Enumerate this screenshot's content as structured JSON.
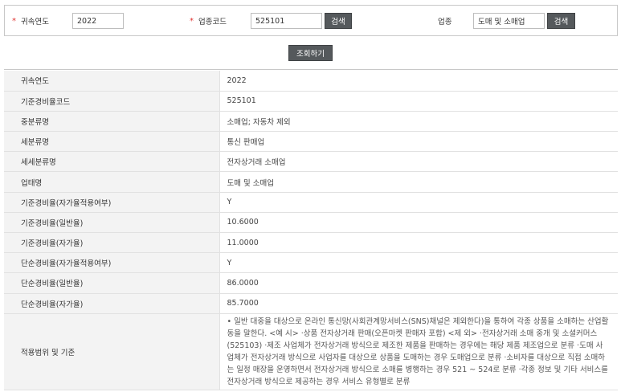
{
  "search": {
    "year_label": "귀속연도",
    "year_value": "2022",
    "code_label": "업종코드",
    "code_value": "525101",
    "code_search_button": "검색",
    "business_label": "업종",
    "business_value": "도매 및 소매업",
    "business_search_button": "검색",
    "required_mark": "*",
    "query_button": "조회하기"
  },
  "colors": {
    "required": "#e0312f",
    "button": "#55595c",
    "header_cell": "#f3f3f3"
  },
  "rows": [
    {
      "label": "귀속연도",
      "value": "2022"
    },
    {
      "label": "기준경비율코드",
      "value": "525101"
    },
    {
      "label": "중분류명",
      "value": "소매업; 자동차 제외"
    },
    {
      "label": "세분류명",
      "value": "통신 판매업"
    },
    {
      "label": "세세분류명",
      "value": "전자상거래 소매업"
    },
    {
      "label": "업태명",
      "value": "도매 및 소매업"
    },
    {
      "label": "기준경비율(자가율적용여부)",
      "value": "Y"
    },
    {
      "label": "기준경비율(일반율)",
      "value": "10.6000"
    },
    {
      "label": "기준경비율(자가율)",
      "value": "11.0000"
    },
    {
      "label": "단순경비율(자가율적용여부)",
      "value": "Y"
    },
    {
      "label": "단순경비율(일반율)",
      "value": "86.0000"
    },
    {
      "label": "단순경비율(자가율)",
      "value": "85.7000"
    },
    {
      "label": "적용범위 및 기준",
      "value": "• 일반 대중을 대상으로 온라인 통신망(사회관계망서비스(SNS)채널은 제외한다)을 통하여 각종 상품을 소매하는 산업활동을 말한다. <예 시> ·상품 전자상거래 판매(오픈마켓 판매자 포함) <제 외> ·전자상거래 소매 중개 및 소셜커머스(525103) ·제조 사업체가 전자상거래 방식으로 제조한 제품을 판매하는 경우에는 해당 제품 제조업으로 분류 ·도매 사업체가 전자상거래 방식으로 사업자를 대상으로 상품을 도매하는 경우 도매업으로 분류 ·소비자를 대상으로 직접 소매하는 일정 매장을 운영하면서 전자상거래 방식으로 소매를 병행하는 경우 521 ~ 524로 분류 ·각종 정보 및 기타 서비스를 전자상거래 방식으로 제공하는 경우 서비스 유형별로 분류"
    }
  ]
}
